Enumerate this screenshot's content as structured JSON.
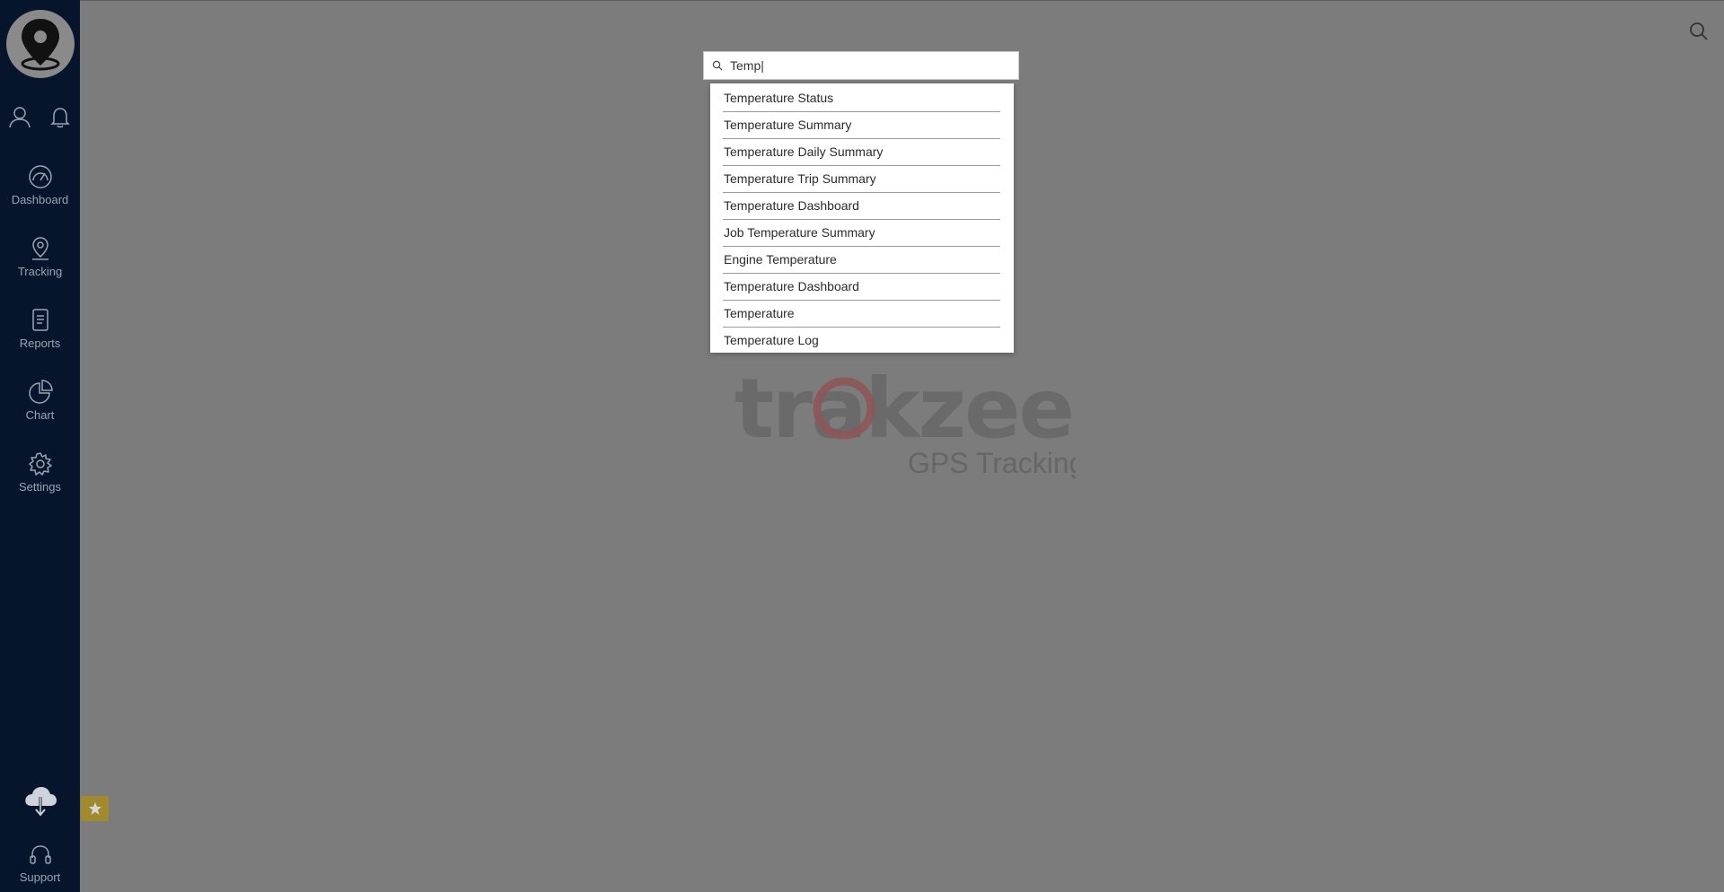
{
  "sidebar": {
    "nav": [
      {
        "label": "Dashboard",
        "icon": "speedometer-icon"
      },
      {
        "label": "Tracking",
        "icon": "map-pin-icon"
      },
      {
        "label": "Reports",
        "icon": "document-icon"
      },
      {
        "label": "Chart",
        "icon": "pie-chart-icon"
      },
      {
        "label": "Settings",
        "icon": "gear-icon"
      }
    ],
    "support_label": "Support"
  },
  "search": {
    "value": "Temp|",
    "results": [
      "Temperature Status",
      "Temperature Summary",
      "Temperature Daily Summary",
      "Temperature Trip Summary",
      "Temperature Dashboard",
      "Job Temperature Summary",
      "Engine Temperature",
      "Temperature Dashboard",
      "Temperature",
      "Temperature Log"
    ]
  },
  "watermark": {
    "brand": "trakzee",
    "tagline": "GPS Tracking"
  },
  "colors": {
    "sidebar_bg": "#07152c",
    "overlay_bg": "#7c7c7c",
    "favorite_bg": "#a08a2c"
  }
}
